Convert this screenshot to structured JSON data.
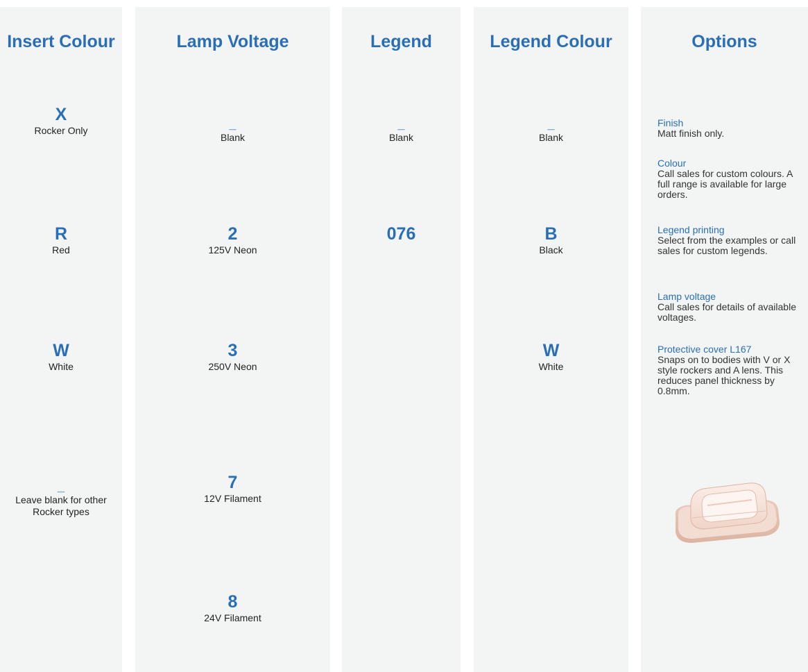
{
  "columns": {
    "insert_colour": {
      "header": "Insert Colour",
      "entries": [
        {
          "code": "X",
          "label": "Rocker Only"
        },
        {
          "code": "R",
          "label": "Red"
        },
        {
          "code": "W",
          "label": "White"
        },
        {
          "code": "_",
          "label": "Leave blank for other Rocker types"
        }
      ]
    },
    "lamp_voltage": {
      "header": "Lamp Voltage",
      "entries": [
        {
          "code": "_",
          "label": "Blank"
        },
        {
          "code": "2",
          "label": "125V Neon"
        },
        {
          "code": "3",
          "label": "250V Neon"
        },
        {
          "code": "7",
          "label": "12V Filament"
        },
        {
          "code": "8",
          "label": "24V Filament"
        }
      ]
    },
    "legend": {
      "header": "Legend",
      "entries": [
        {
          "code": "_",
          "label": "Blank"
        },
        {
          "code": "076",
          "label": ""
        }
      ]
    },
    "legend_colour": {
      "header": "Legend Colour",
      "entries": [
        {
          "code": "_",
          "label": "Blank"
        },
        {
          "code": "B",
          "label": "Black"
        },
        {
          "code": "W",
          "label": "White"
        }
      ]
    },
    "options": {
      "header": "Options",
      "items": [
        {
          "title": "Finish",
          "body": "Matt finish only."
        },
        {
          "title": "Colour",
          "body": "Call sales for custom colours. A full range is available for large orders."
        },
        {
          "title": "Legend printing",
          "body": "Select from the examples or call sales for custom legends."
        },
        {
          "title": "Lamp voltage",
          "body": "Call sales for details of available voltages."
        },
        {
          "title": "Protective cover L167",
          "body": "Snaps on to bodies with V or X style rockers and A lens. This reduces panel thickness by 0.8mm."
        }
      ]
    }
  },
  "colors": {
    "accent": "#2a6fb5",
    "column_bg": "#f3f4f4",
    "text": "#222222"
  },
  "icons": {
    "cover": "protective-cover-image"
  }
}
